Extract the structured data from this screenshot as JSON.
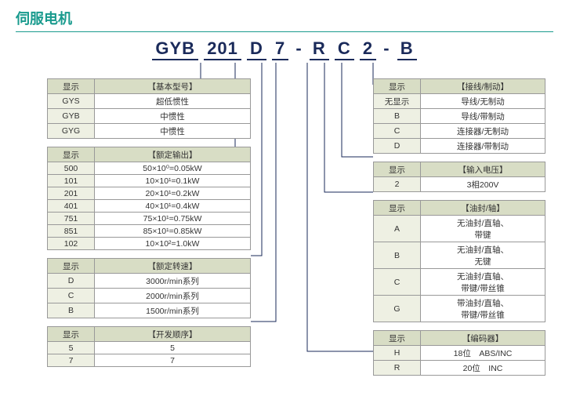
{
  "page_title": "伺服电机",
  "partnum": {
    "seg1": "GYB",
    "seg2": "201",
    "seg3": "D",
    "seg4": "7",
    "sep1": "-",
    "seg5": "R",
    "seg6": "C",
    "seg7": "2",
    "sep2": "-",
    "seg8": "B"
  },
  "tables": {
    "basic": {
      "h1": "显示",
      "h2": "【基本型号】",
      "rows": [
        {
          "l": "GYS",
          "r": "超低惯性"
        },
        {
          "l": "GYB",
          "r": "中惯性"
        },
        {
          "l": "GYG",
          "r": "中惯性"
        }
      ]
    },
    "output": {
      "h1": "显示",
      "h2": "【额定输出】",
      "rows": [
        {
          "l": "500",
          "r": "50×10⁰=0.05kW"
        },
        {
          "l": "101",
          "r": "10×10¹=0.1kW"
        },
        {
          "l": "201",
          "r": "20×10¹=0.2kW"
        },
        {
          "l": "401",
          "r": "40×10¹=0.4kW"
        },
        {
          "l": "751",
          "r": "75×10¹=0.75kW"
        },
        {
          "l": "851",
          "r": "85×10¹=0.85kW"
        },
        {
          "l": "102",
          "r": "10×10²=1.0kW"
        }
      ]
    },
    "speed": {
      "h1": "显示",
      "h2": "【额定转速】",
      "rows": [
        {
          "l": "D",
          "r": "3000r/min系列"
        },
        {
          "l": "C",
          "r": "2000r/min系列"
        },
        {
          "l": "B",
          "r": "1500r/min系列"
        }
      ]
    },
    "dev": {
      "h1": "显示",
      "h2": "【开发顺序】",
      "rows": [
        {
          "l": "5",
          "r": "5"
        },
        {
          "l": "7",
          "r": "7"
        }
      ]
    },
    "wire": {
      "h1": "显示",
      "h2": "【接线/制动】",
      "rows": [
        {
          "l": "无显示",
          "r": "导线/无制动"
        },
        {
          "l": "B",
          "r": "导线/带制动"
        },
        {
          "l": "C",
          "r": "连接器/无制动"
        },
        {
          "l": "D",
          "r": "连接器/带制动"
        }
      ]
    },
    "voltage": {
      "h1": "显示",
      "h2": "【输入电压】",
      "rows": [
        {
          "l": "2",
          "r": "3相200V"
        }
      ]
    },
    "seal": {
      "h1": "显示",
      "h2": "【油封/轴】",
      "rows": [
        {
          "l": "A",
          "r": "无油封/直轴、带键"
        },
        {
          "l": "B",
          "r": "无油封/直轴、无键"
        },
        {
          "l": "C",
          "r": "无油封/直轴、带键/带丝锥"
        },
        {
          "l": "G",
          "r": "带油封/直轴、带键/带丝锥"
        }
      ]
    },
    "encoder": {
      "h1": "显示",
      "h2": "【编码器】",
      "rows": [
        {
          "l": "H",
          "r": "18位　ABS/INC"
        },
        {
          "l": "R",
          "r": "20位　INC"
        }
      ]
    }
  }
}
